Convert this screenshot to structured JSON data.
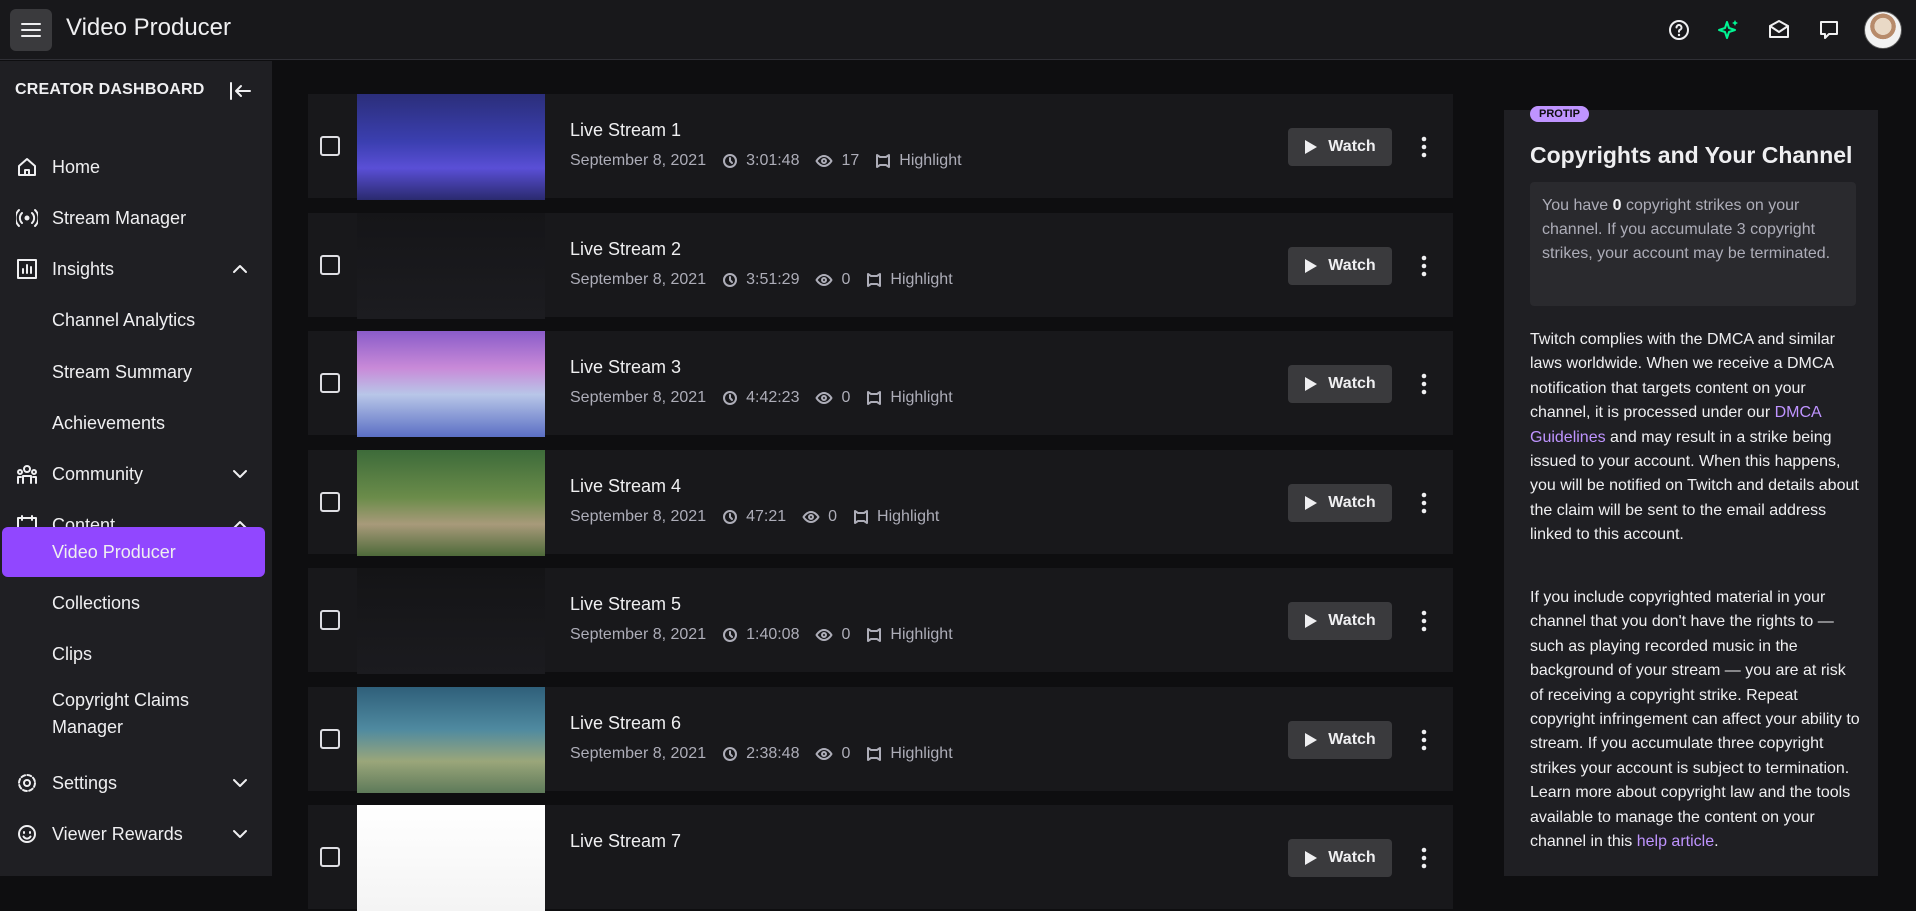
{
  "app": {
    "title": "Video Producer"
  },
  "topbar": {
    "icons": [
      "help-icon",
      "sparkle-icon",
      "inbox-icon",
      "whispers-icon"
    ],
    "accent": "#00f593"
  },
  "sidebar": {
    "header": "CREATOR DASHBOARD",
    "items": [
      {
        "label": "Home",
        "icon": "home-icon"
      },
      {
        "label": "Stream Manager",
        "icon": "stream-icon"
      },
      {
        "label": "Insights",
        "icon": "insights-icon",
        "expanded": true
      },
      {
        "label": "Channel Analytics"
      },
      {
        "label": "Stream Summary"
      },
      {
        "label": "Achievements"
      },
      {
        "label": "Community",
        "icon": "community-icon",
        "expanded": false
      },
      {
        "label": "Content",
        "icon": "content-icon",
        "expanded": true
      },
      {
        "label": "Video Producer",
        "active": true
      },
      {
        "label": "Collections"
      },
      {
        "label": "Clips"
      },
      {
        "label": "Copyright Claims",
        "label2": "Manager"
      },
      {
        "label": "Settings",
        "icon": "settings-icon",
        "expanded": false
      },
      {
        "label": "Viewer Rewards",
        "icon": "rewards-icon",
        "expanded": false
      }
    ],
    "active_color": "#9147ff"
  },
  "videos": [
    {
      "title": "Live Stream 1",
      "date": "September 8, 2021",
      "duration": "3:01:48",
      "views": "17",
      "type": "Highlight",
      "watch": "Watch"
    },
    {
      "title": "Live Stream 2",
      "date": "September 8, 2021",
      "duration": "3:51:29",
      "views": "0",
      "type": "Highlight",
      "watch": "Watch"
    },
    {
      "title": "Live Stream 3",
      "date": "September 8, 2021",
      "duration": "4:42:23",
      "views": "0",
      "type": "Highlight",
      "watch": "Watch"
    },
    {
      "title": "Live Stream 4",
      "date": "September 8, 2021",
      "duration": "47:21",
      "views": "0",
      "type": "Highlight",
      "watch": "Watch"
    },
    {
      "title": "Live Stream 5",
      "date": "September 8, 2021",
      "duration": "1:40:08",
      "views": "0",
      "type": "Highlight",
      "watch": "Watch"
    },
    {
      "title": "Live Stream 6",
      "date": "September 8, 2021",
      "duration": "2:38:48",
      "views": "0",
      "type": "Highlight",
      "watch": "Watch"
    },
    {
      "title": "Live Stream 7",
      "date": "",
      "duration": "",
      "views": "",
      "type": "",
      "watch": "Watch"
    }
  ],
  "panel": {
    "badge": "PROTIP",
    "title": "Copyrights and Your Channel",
    "strikes_pre": "You have ",
    "strikes_count": "0",
    "strikes_post": " copyright strikes on your channel. If you accumulate 3 copyright strikes, your account may be terminated.",
    "p1_pre": "Twitch complies with the DMCA and similar laws worldwide. When we receive a DMCA notification that targets content on your channel, it is processed under our ",
    "p1_link": "DMCA Guidelines",
    "p1_post": " and may result in a strike being issued to your account. When this happens, you will be notified on Twitch and details about the claim will be sent to the email address linked to this account.",
    "p2_pre": "If you include copyrighted material in your channel that you don't have the rights to — such as playing recorded music in the background of your stream — you are at risk of receiving a copyright strike. Repeat copyright infringement can affect your ability to stream. If you accumulate three copyright strikes your account is subject to termination. Learn more about copyright law and the tools available to manage the content on your channel in this ",
    "p2_link": "help article",
    "p2_post": ".",
    "link_color": "#bf94ff"
  }
}
